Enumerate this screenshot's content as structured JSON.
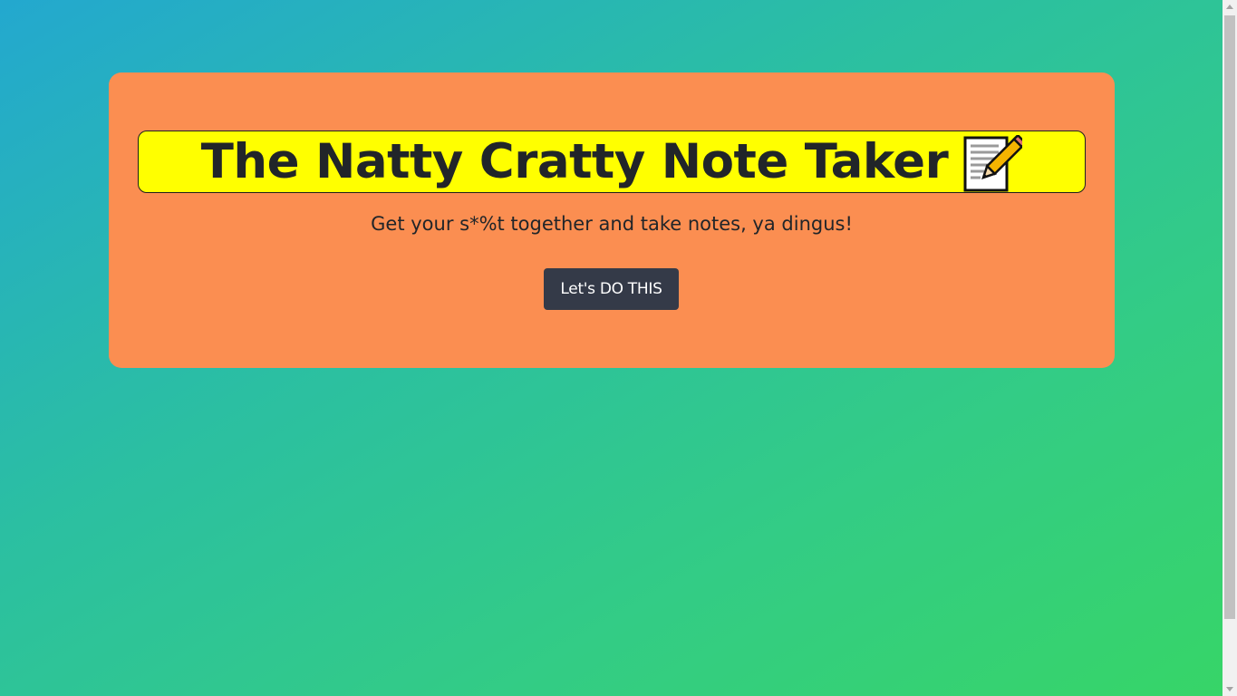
{
  "hero": {
    "title": "The Natty Cratty Note Taker",
    "title_icon": "memo-icon",
    "tagline": "Get your s*%t together and take notes, ya dingus!",
    "cta_label": "Let's DO THIS"
  },
  "colors": {
    "background_gradient": [
      "#23a8cf",
      "#33cc85",
      "#37d567"
    ],
    "jumbotron": "#fb8e51",
    "title_highlight": "#ffff00",
    "button": "#343a48",
    "text": "#212529"
  },
  "scrollbar": {
    "thumb_fraction": 0.87
  }
}
